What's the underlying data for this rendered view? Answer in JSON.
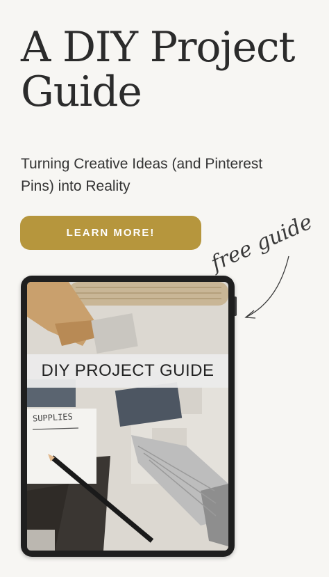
{
  "header": {
    "title": "A DIY Project Guide",
    "subtitle": "Turning Creative Ideas (and Pinterest Pins) into Reality"
  },
  "cta": {
    "label": "LEARN MORE!"
  },
  "annotation": {
    "text": "free guide"
  },
  "tablet": {
    "screen_title": "DIY PROJECT GUIDE",
    "note_text": "SUPPLIES"
  },
  "colors": {
    "background": "#f7f6f3",
    "accent_gold": "#b6963d",
    "text_dark": "#2b2b2b"
  }
}
